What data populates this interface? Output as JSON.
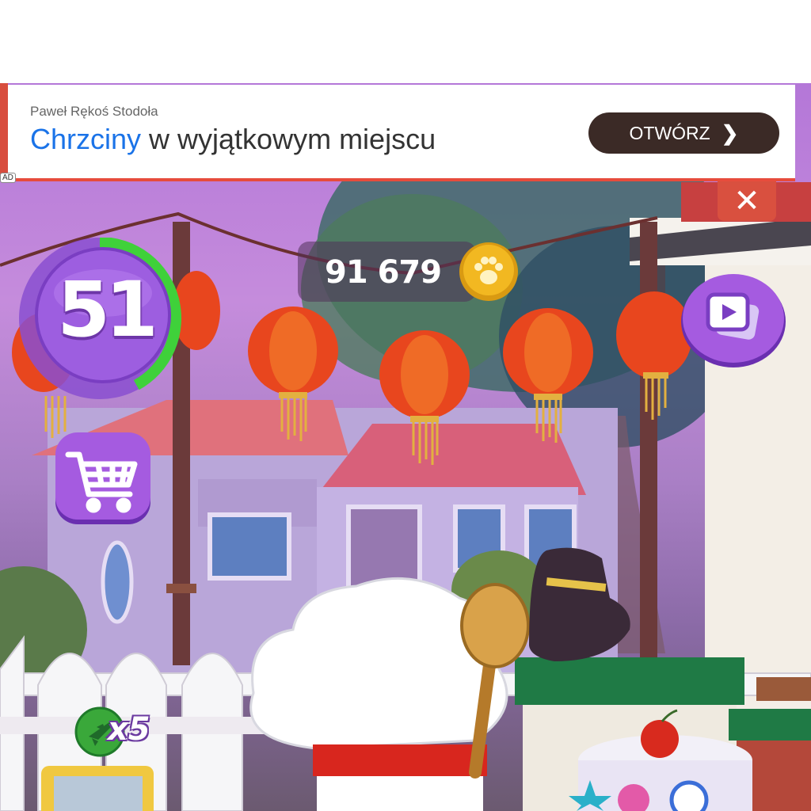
{
  "ad": {
    "sponsor": "Paweł Rękoś Stodoła",
    "headline_keyword": "Chrzciny",
    "headline_rest": " w wyjątkowym miejscu",
    "cta_label": "OTWÓRZ",
    "cta_icon": "chevron-right-icon",
    "badge": "AD",
    "close_icon": "close-icon",
    "close_symbol": "✕",
    "chevron_symbol": "❯"
  },
  "hud": {
    "coins": "91 679",
    "coin_icon": "paw-coin-icon",
    "level": "51",
    "level_progress": 0.42,
    "shop_icon": "shopping-cart-icon",
    "video_icon": "video-play-icon",
    "powerup_icon": "airplane-icon",
    "powerup_count": "x5"
  },
  "colors": {
    "ad_accent": "#e74c3c",
    "ad_link": "#1a73e8",
    "cta_bg": "#3b2a26",
    "button_purple": "#a55be0",
    "progress_green": "#3fd13a",
    "coin_gold": "#f2b821"
  }
}
